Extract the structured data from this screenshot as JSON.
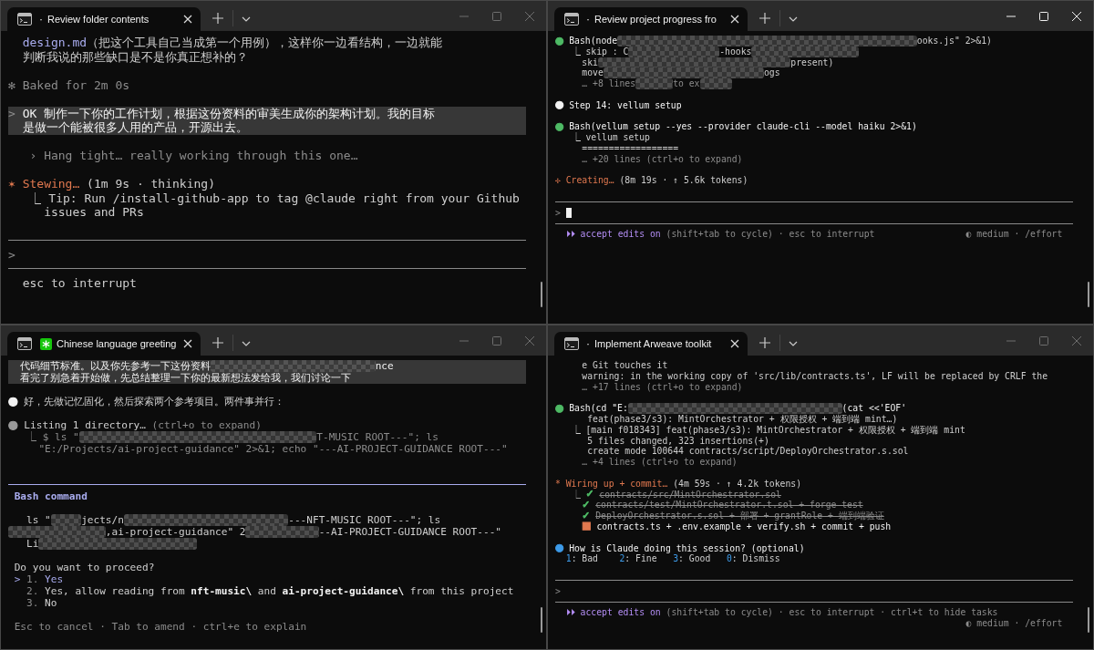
{
  "panes": [
    {
      "focused": false,
      "tab": {
        "title": "Review folder contents",
        "marker": {
          "kind": "dot",
          "text": "·"
        }
      },
      "lines": [
        {
          "kind": "text",
          "segs": [
            {
              "kind": "path",
              "text": "  design.md"
            },
            {
              "kind": "plain",
              "text": "（把这个工具自己当成第一个用例），这样你一边看结构，一边就能"
            }
          ]
        },
        {
          "kind": "text",
          "segs": [
            {
              "kind": "plain",
              "text": "  判断我说的那些缺口是不是你真正想补的？"
            }
          ]
        },
        {
          "kind": "blank"
        },
        {
          "kind": "text",
          "segs": [
            {
              "kind": "dim",
              "text": "✻ Baked for 2m 0s"
            }
          ]
        },
        {
          "kind": "blank"
        },
        {
          "kind": "user",
          "segs": [
            {
              "kind": "prompt",
              "text": ">"
            },
            {
              "kind": "bright",
              "text": " OK 制作一下你的工作计划，根据这份资料的审美生成你的架构计划。我的目标"
            }
          ]
        },
        {
          "kind": "user",
          "segs": [
            {
              "kind": "bright",
              "text": "  是做一个能被很多人用的产品，开源出去。"
            }
          ]
        },
        {
          "kind": "blank"
        },
        {
          "kind": "text",
          "segs": [
            {
              "kind": "dim",
              "text": "   › Hang tight… really working through this one…"
            }
          ]
        },
        {
          "kind": "blank"
        },
        {
          "kind": "text",
          "segs": [
            {
              "kind": "orange",
              "text": "✶ Stewing…"
            },
            {
              "kind": "plain",
              "text": " (1m 9s · thinking)"
            }
          ]
        },
        {
          "kind": "text",
          "segs": [
            {
              "kind": "plain",
              "text": "   ⎿ Tip: Run /install-github-app to tag @claude right from your Github"
            }
          ]
        },
        {
          "kind": "text",
          "segs": [
            {
              "kind": "plain",
              "text": "     issues and PRs"
            }
          ]
        },
        {
          "kind": "blank"
        },
        {
          "kind": "rule"
        },
        {
          "kind": "input",
          "prompt": ">",
          "cursor": false
        },
        {
          "kind": "rule"
        },
        {
          "kind": "text",
          "segs": [
            {
              "kind": "plain",
              "text": "  esc to interrupt"
            }
          ]
        }
      ]
    },
    {
      "focused": true,
      "tab": {
        "title": "Review project progress fro",
        "marker": {
          "kind": "dot",
          "text": "·"
        }
      },
      "lines": [
        {
          "kind": "text",
          "segs": [
            {
              "kind": "mark",
              "text": "●",
              "color": "#4eba65"
            },
            {
              "kind": "bright",
              "text": " Bash(node"
            },
            {
              "kind": "redacted"
            },
            {
              "kind": "plain",
              "text": "ooks.js\" 2>&1)"
            }
          ]
        },
        {
          "kind": "text",
          "segs": [
            {
              "kind": "plain",
              "text": "   ⎿ skip : C"
            },
            {
              "kind": "redacted"
            },
            {
              "kind": "plain",
              "text": "-hooks"
            },
            {
              "kind": "redacted"
            }
          ]
        },
        {
          "kind": "text",
          "segs": [
            {
              "kind": "plain",
              "text": "     ski"
            },
            {
              "kind": "redacted"
            },
            {
              "kind": "plain",
              "text": "present)"
            }
          ]
        },
        {
          "kind": "text",
          "segs": [
            {
              "kind": "plain",
              "text": "     move"
            },
            {
              "kind": "redacted"
            },
            {
              "kind": "plain",
              "text": "ogs"
            }
          ]
        },
        {
          "kind": "text",
          "segs": [
            {
              "kind": "dim",
              "text": "     … +8 lines"
            },
            {
              "kind": "redacted"
            },
            {
              "kind": "dim",
              "text": "to ex"
            },
            {
              "kind": "redacted"
            }
          ]
        },
        {
          "kind": "blank"
        },
        {
          "kind": "text",
          "segs": [
            {
              "kind": "mark",
              "text": "●",
              "color": "#f2f2f2"
            },
            {
              "kind": "bright",
              "text": " Step 14: vellum setup"
            }
          ]
        },
        {
          "kind": "blank"
        },
        {
          "kind": "text",
          "segs": [
            {
              "kind": "mark",
              "text": "●",
              "color": "#4eba65"
            },
            {
              "kind": "bright",
              "text": " Bash(vellum setup --yes --provider claude-cli --model haiku 2>&1)"
            }
          ]
        },
        {
          "kind": "text",
          "segs": [
            {
              "kind": "plain",
              "text": "   ⎿ vellum setup"
            }
          ]
        },
        {
          "kind": "text",
          "segs": [
            {
              "kind": "plain",
              "text": "     =================="
            }
          ]
        },
        {
          "kind": "text",
          "segs": [
            {
              "kind": "dim",
              "text": "     … +20 lines (ctrl+o to expand)"
            }
          ]
        },
        {
          "kind": "blank"
        },
        {
          "kind": "text",
          "segs": [
            {
              "kind": "orange",
              "text": "✢ Creating…"
            },
            {
              "kind": "plain",
              "text": " (8m 19s · ↑ 5.6k tokens)"
            }
          ]
        },
        {
          "kind": "blank"
        },
        {
          "kind": "rule"
        },
        {
          "kind": "input",
          "prompt": ">",
          "cursor": true
        },
        {
          "kind": "rule"
        },
        {
          "kind": "status",
          "left": [
            {
              "kind": "purple",
              "text": "  ⏵⏵ accept edits on"
            },
            {
              "kind": "dim",
              "text": " (shift+tab to cycle) · esc to interrupt"
            }
          ],
          "right": [
            {
              "kind": "dim",
              "text": "◐ medium · /effort"
            }
          ]
        }
      ]
    },
    {
      "focused": false,
      "tab": {
        "title": "Chinese language greeting",
        "marker": {
          "kind": "spark"
        }
      },
      "lines": [
        {
          "kind": "user",
          "segs": [
            {
              "kind": "bright",
              "text": "  代码细节标准。以及你先参考一下这份资料"
            },
            {
              "kind": "redacted"
            },
            {
              "kind": "bright",
              "text": "nce"
            }
          ]
        },
        {
          "kind": "user",
          "segs": [
            {
              "kind": "bright",
              "text": "  看完了别急着开始做，先总结整理一下你的最新想法发给我，我们讨论一下"
            }
          ]
        },
        {
          "kind": "blank"
        },
        {
          "kind": "text",
          "segs": [
            {
              "kind": "mark",
              "text": "●",
              "color": "#f2f2f2"
            },
            {
              "kind": "plain",
              "text": " 好，先做记忆固化，然后探索两个参考项目。两件事并行："
            }
          ]
        },
        {
          "kind": "blank"
        },
        {
          "kind": "text",
          "segs": [
            {
              "kind": "mark",
              "text": "●",
              "color": "#9a9a9a"
            },
            {
              "kind": "plain",
              "text": " Listing 1 directory…"
            },
            {
              "kind": "dim",
              "text": " (ctrl+o to expand)"
            }
          ]
        },
        {
          "kind": "text",
          "segs": [
            {
              "kind": "dim",
              "text": "   ⎿ $ ls \""
            },
            {
              "kind": "redacted"
            },
            {
              "kind": "dim",
              "text": "T-MUSIC ROOT---\"; ls"
            }
          ]
        },
        {
          "kind": "text",
          "segs": [
            {
              "kind": "dim",
              "text": "     \"E:/Projects/ai-project-guidance\" 2>&1; echo \"---AI-PROJECT-GUIDANCE ROOT---\""
            }
          ]
        },
        {
          "kind": "blank"
        },
        {
          "kind": "blank"
        },
        {
          "kind": "accent-rule"
        },
        {
          "kind": "text",
          "segs": [
            {
              "kind": "accent",
              "text": " Bash command"
            }
          ]
        },
        {
          "kind": "blank"
        },
        {
          "kind": "text",
          "segs": [
            {
              "kind": "plain",
              "text": "   ls \""
            },
            {
              "kind": "redacted"
            },
            {
              "kind": "plain",
              "text": "jects/n"
            },
            {
              "kind": "redacted"
            },
            {
              "kind": "plain",
              "text": "---NFT-MUSIC ROOT---\"; ls"
            }
          ]
        },
        {
          "kind": "text",
          "segs": [
            {
              "kind": "redacted"
            },
            {
              "kind": "plain",
              "text": ",ai-project-guidance\" 2"
            },
            {
              "kind": "redacted"
            },
            {
              "kind": "plain",
              "text": "--AI-PROJECT-GUIDANCE ROOT---\""
            }
          ]
        },
        {
          "kind": "text",
          "segs": [
            {
              "kind": "plain",
              "text": "   Li"
            },
            {
              "kind": "redacted"
            }
          ]
        },
        {
          "kind": "blank"
        },
        {
          "kind": "text",
          "segs": [
            {
              "kind": "plain",
              "text": " Do you want to proceed?"
            }
          ]
        },
        {
          "kind": "options",
          "pointer": ">",
          "items": [
            {
              "number": "1.",
              "selected": true,
              "segs": [
                {
                  "kind": "plain",
                  "text": "Yes"
                }
              ]
            },
            {
              "number": "2.",
              "selected": false,
              "segs": [
                {
                  "kind": "plain",
                  "text": "Yes, allow reading from "
                },
                {
                  "kind": "bold",
                  "text": "nft-music\\"
                },
                {
                  "kind": "plain",
                  "text": " and "
                },
                {
                  "kind": "bold",
                  "text": "ai-project-guidance\\"
                },
                {
                  "kind": "plain",
                  "text": " from this project"
                }
              ]
            },
            {
              "number": "3.",
              "selected": false,
              "segs": [
                {
                  "kind": "plain",
                  "text": "No"
                }
              ]
            }
          ]
        },
        {
          "kind": "blank"
        },
        {
          "kind": "text",
          "segs": [
            {
              "kind": "dim",
              "text": " Esc to cancel · Tab to amend · ctrl+e to explain"
            }
          ]
        }
      ]
    },
    {
      "focused": false,
      "tab": {
        "title": "Implement Arweave toolkit",
        "marker": {
          "kind": "dot",
          "text": "·"
        }
      },
      "lines": [
        {
          "kind": "text",
          "segs": [
            {
              "kind": "plain",
              "text": "     e Git touches it"
            }
          ]
        },
        {
          "kind": "text",
          "segs": [
            {
              "kind": "plain",
              "text": "     warning: in the working copy of 'src/lib/contracts.ts', LF will be replaced by CRLF the"
            }
          ]
        },
        {
          "kind": "text",
          "segs": [
            {
              "kind": "dim",
              "text": "     … +17 lines (ctrl+o to expand)"
            }
          ]
        },
        {
          "kind": "blank"
        },
        {
          "kind": "text",
          "segs": [
            {
              "kind": "mark",
              "text": "●",
              "color": "#4eba65"
            },
            {
              "kind": "bright",
              "text": " Bash(cd \"E:"
            },
            {
              "kind": "redacted"
            },
            {
              "kind": "bright",
              "text": "(cat <<'EOF'"
            }
          ]
        },
        {
          "kind": "text",
          "segs": [
            {
              "kind": "plain",
              "text": "      feat(phase3/s3): MintOrchestrator + 权限授权 + 端到端 mint…)"
            }
          ]
        },
        {
          "kind": "text",
          "segs": [
            {
              "kind": "plain",
              "text": "   ⎿ [main f018343] feat(phase3/s3): MintOrchestrator + 权限授权 + 端到端 mint"
            }
          ]
        },
        {
          "kind": "text",
          "segs": [
            {
              "kind": "plain",
              "text": "      5 files changed, 323 insertions(+)"
            }
          ]
        },
        {
          "kind": "text",
          "segs": [
            {
              "kind": "plain",
              "text": "      create mode 100644 contracts/script/DeployOrchestrator.s.sol"
            }
          ]
        },
        {
          "kind": "text",
          "segs": [
            {
              "kind": "dim",
              "text": "     … +4 lines (ctrl+o to expand)"
            }
          ]
        },
        {
          "kind": "blank"
        },
        {
          "kind": "text",
          "segs": [
            {
              "kind": "orange",
              "text": "* Wiring up + commit…"
            },
            {
              "kind": "plain",
              "text": " (4m 59s · ↑ 4.2k tokens)"
            }
          ]
        },
        {
          "kind": "text",
          "segs": [
            {
              "kind": "dim",
              "text": "   ⎿"
            },
            {
              "kind": "mark",
              "text": " ✓",
              "color": "#4eba65"
            },
            {
              "kind": "done",
              "text": " contracts/src/MintOrchestrator.sol"
            }
          ]
        },
        {
          "kind": "text",
          "segs": [
            {
              "kind": "mark",
              "text": "     ✓",
              "color": "#4eba65"
            },
            {
              "kind": "done",
              "text": " contracts/test/MintOrchestrator.t.sol + forge test"
            }
          ]
        },
        {
          "kind": "text",
          "segs": [
            {
              "kind": "mark",
              "text": "     ✓",
              "color": "#4eba65"
            },
            {
              "kind": "done",
              "text": " DeployOrchestrator.s.sol + 部署 + grantRole + 端到端验证"
            }
          ]
        },
        {
          "kind": "text",
          "segs": [
            {
              "kind": "mark",
              "text": "     ■",
              "color": "#e0784f"
            },
            {
              "kind": "bright",
              "text": " contracts.ts + .env.example + verify.sh + commit + push"
            }
          ]
        },
        {
          "kind": "blank"
        },
        {
          "kind": "text",
          "segs": [
            {
              "kind": "mark",
              "text": "●",
              "color": "#3d9be9"
            },
            {
              "kind": "bright",
              "text": " How is Claude doing this session? (optional)"
            }
          ]
        },
        {
          "kind": "text",
          "segs": [
            {
              "kind": "blue",
              "text": "  1"
            },
            {
              "kind": "plain",
              "text": ": Bad    "
            },
            {
              "kind": "blue",
              "text": "2"
            },
            {
              "kind": "plain",
              "text": ": Fine   "
            },
            {
              "kind": "blue",
              "text": "3"
            },
            {
              "kind": "plain",
              "text": ": Good   "
            },
            {
              "kind": "blue",
              "text": "0"
            },
            {
              "kind": "plain",
              "text": ": Dismiss"
            }
          ]
        },
        {
          "kind": "blank"
        },
        {
          "kind": "rule"
        },
        {
          "kind": "input",
          "prompt": ">",
          "cursor": false
        },
        {
          "kind": "rule"
        },
        {
          "kind": "status",
          "left": [
            {
              "kind": "purple",
              "text": "  ⏵⏵ accept edits on"
            },
            {
              "kind": "dim",
              "text": " (shift+tab to cycle) · esc to interrupt · ctrl+t to hide tasks"
            }
          ]
        },
        {
          "kind": "right",
          "right": [
            {
              "kind": "dim",
              "text": "◐ medium · /effort"
            }
          ]
        }
      ]
    }
  ]
}
